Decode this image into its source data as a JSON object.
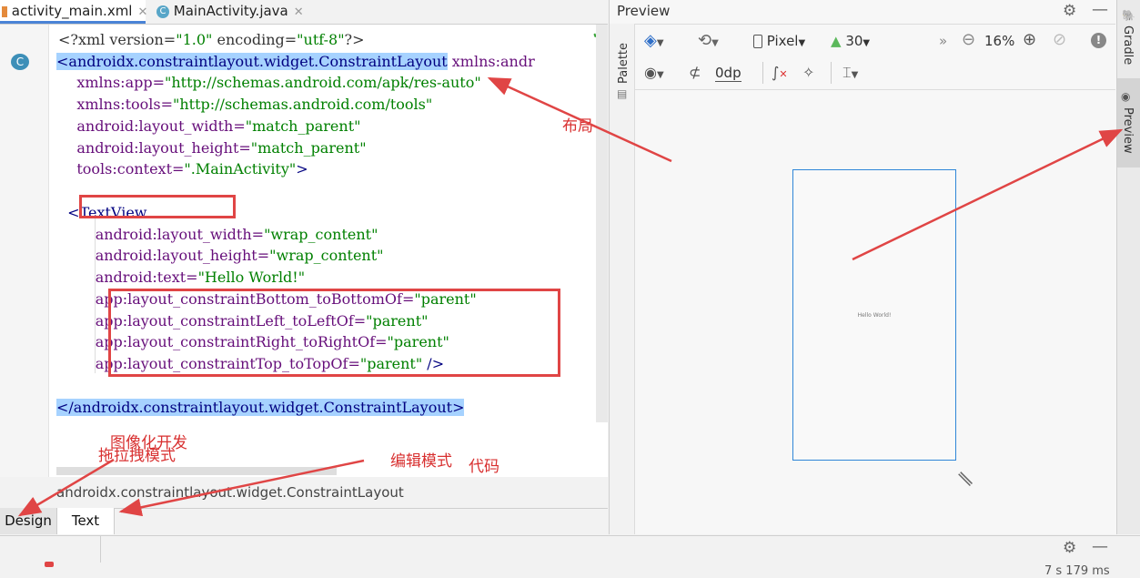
{
  "tabs": [
    {
      "label": "activity_main.xml",
      "close": "✕",
      "icon": "xml-file-icon"
    },
    {
      "label": "MainActivity.java",
      "close": "✕",
      "icon": "class-file-icon"
    }
  ],
  "code": {
    "l1": {
      "a": "<?xml version=",
      "b": "\"1.0\"",
      "c": " encoding=",
      "d": "\"utf-8\"",
      "e": "?>"
    },
    "l2": {
      "a": "<androidx.constraintlayout.widget.ConstraintLayout",
      "b": " xmlns:andr"
    },
    "l3": {
      "a": "    xmlns:app=",
      "b": "\"http://schemas.android.com/apk/res-auto\""
    },
    "l4": {
      "a": "    xmlns:tools=",
      "b": "\"http://schemas.android.com/tools\""
    },
    "l5": {
      "a": "    android:layout_width=",
      "b": "\"match_parent\""
    },
    "l6": {
      "a": "    android:layout_height=",
      "b": "\"match_parent\""
    },
    "l7": {
      "a": "    tools:context=",
      "b": "\".MainActivity\"",
      "c": ">"
    },
    "l9": {
      "a": "  <TextView"
    },
    "l10": {
      "a": "        android:layout_width=",
      "b": "\"wrap_content\""
    },
    "l11": {
      "a": "        android:layout_height=",
      "b": "\"wrap_content\""
    },
    "l12": {
      "a": "        android:text=",
      "b": "\"Hello World!\""
    },
    "l13": {
      "a": "        app:layout_constraintBottom_toBottomOf=",
      "b": "\"parent\""
    },
    "l14": {
      "a": "        app:layout_constraintLeft_toLeftOf=",
      "b": "\"parent\""
    },
    "l15": {
      "a": "        app:layout_constraintRight_toRightOf=",
      "b": "\"parent\""
    },
    "l16": {
      "a": "        app:layout_constraintTop_toTopOf=",
      "b": "\"parent\"",
      "c": " />"
    },
    "l18": {
      "a": "</androidx.constraintlayout.widget.ConstraintLayout>"
    }
  },
  "breadcrumb": "androidx.constraintlayout.widget.ConstraintLayout",
  "bottom_tabs": {
    "design": "Design",
    "text": "Text"
  },
  "preview": {
    "title": "Preview",
    "palette": "Palette",
    "device": "Pixel",
    "api": "30",
    "zoom": "16%",
    "margin": "0dp",
    "hello": "Hello World!",
    "more": "»"
  },
  "right_strip": {
    "gradle": "Gradle",
    "preview": "Preview"
  },
  "annotations": {
    "layout": "布局",
    "image_dev": "图像化开发",
    "drag_mode": "拖拉拽模式",
    "edit_mode": "编辑模式",
    "code": "代码"
  },
  "status": {
    "time": "7 s 179 ms"
  },
  "colors": {
    "accent": "#4a83d6",
    "annotation": "#e04545",
    "device_border": "#2f86d8"
  }
}
